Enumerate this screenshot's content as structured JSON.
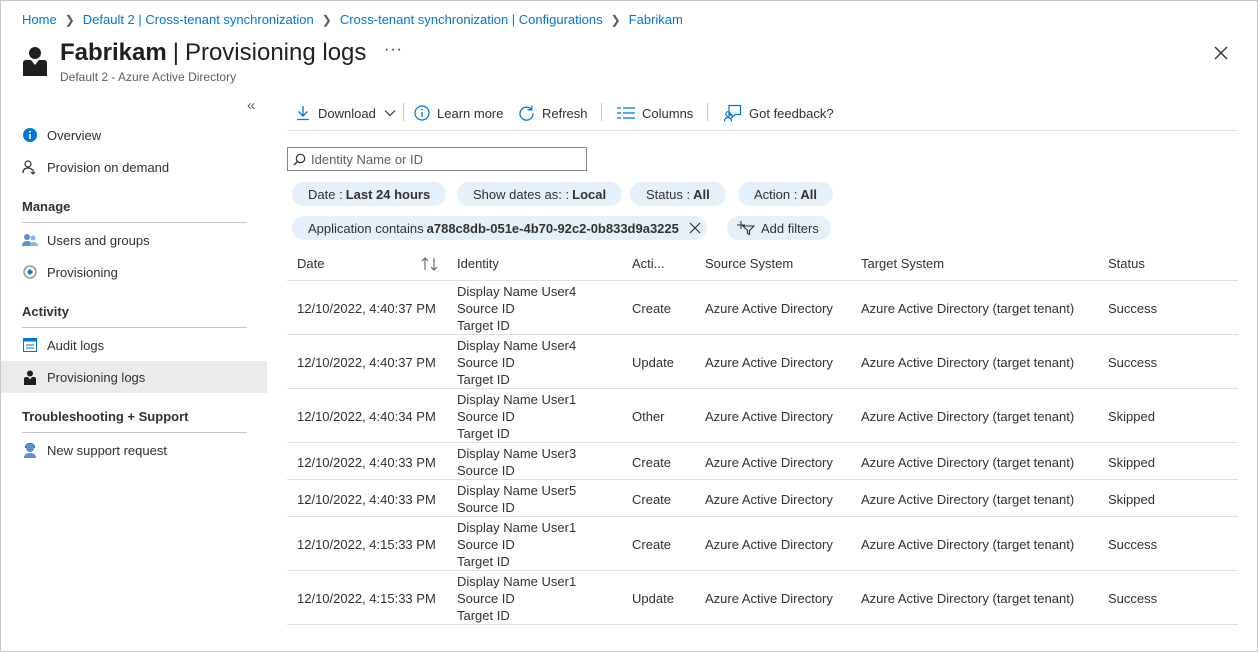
{
  "breadcrumb": [
    "Home",
    "Default 2 | Cross-tenant synchronization",
    "Cross-tenant synchronization | Configurations",
    "Fabrikam"
  ],
  "header": {
    "title_bold": "Fabrikam",
    "title_rest": "Provisioning logs",
    "subtitle": "Default 2 - Azure Active Directory",
    "more": "···"
  },
  "sidebar": {
    "collapse": "«",
    "items": [
      {
        "label": "Overview",
        "icon": "info-icon"
      },
      {
        "label": "Provision on demand",
        "icon": "user-provision-icon"
      }
    ],
    "sections": [
      {
        "heading": "Manage",
        "items": [
          {
            "label": "Users and groups",
            "icon": "users-icon"
          },
          {
            "label": "Provisioning",
            "icon": "provisioning-icon"
          }
        ]
      },
      {
        "heading": "Activity",
        "items": [
          {
            "label": "Audit logs",
            "icon": "audit-icon"
          },
          {
            "label": "Provisioning logs",
            "icon": "person-icon"
          }
        ]
      },
      {
        "heading": "Troubleshooting + Support",
        "items": [
          {
            "label": "New support request",
            "icon": "support-icon"
          }
        ]
      }
    ]
  },
  "toolbar": {
    "download": "Download",
    "learn_more": "Learn more",
    "refresh": "Refresh",
    "columns": "Columns",
    "feedback": "Got feedback?"
  },
  "search": {
    "placeholder": "Identity Name or ID",
    "value": ""
  },
  "filters": {
    "date_label": "Date :",
    "date_value": "Last 24 hours",
    "show_dates_label": "Show dates as: :",
    "show_dates_value": "Local",
    "status_label": "Status :",
    "status_value": "All",
    "action_label": "Action :",
    "action_value": "All",
    "app_label": "Application contains",
    "app_value": "a788c8db-051e-4b70-92c2-0b833d9a3225",
    "add_filters": "Add filters"
  },
  "table": {
    "columns": [
      "Date",
      "Identity",
      "Acti...",
      "Source System",
      "Target System",
      "Status"
    ],
    "rows": [
      {
        "date": "12/10/2022, 4:40:37 PM",
        "identity": [
          "Display Name User4",
          "Source ID",
          "Target ID"
        ],
        "action": "Create",
        "source": "Azure Active Directory",
        "target": "Azure Active Directory (target tenant)",
        "status": "Success"
      },
      {
        "date": "12/10/2022, 4:40:37 PM",
        "identity": [
          "Display Name User4",
          "Source ID",
          "Target ID"
        ],
        "action": "Update",
        "source": "Azure Active Directory",
        "target": "Azure Active Directory (target tenant)",
        "status": "Success"
      },
      {
        "date": "12/10/2022, 4:40:34 PM",
        "identity": [
          "Display Name User1",
          "Source ID",
          "Target ID"
        ],
        "action": "Other",
        "source": "Azure Active Directory",
        "target": "Azure Active Directory (target tenant)",
        "status": "Skipped"
      },
      {
        "date": "12/10/2022, 4:40:33 PM",
        "identity": [
          "Display Name User3",
          "Source ID"
        ],
        "action": "Create",
        "source": "Azure Active Directory",
        "target": "Azure Active Directory (target tenant)",
        "status": "Skipped"
      },
      {
        "date": "12/10/2022, 4:40:33 PM",
        "identity": [
          "Display Name User5",
          "Source ID"
        ],
        "action": "Create",
        "source": "Azure Active Directory",
        "target": "Azure Active Directory (target tenant)",
        "status": "Skipped"
      },
      {
        "date": "12/10/2022, 4:15:33 PM",
        "identity": [
          "Display Name User1",
          "Source ID",
          "Target ID"
        ],
        "action": "Create",
        "source": "Azure Active Directory",
        "target": "Azure Active Directory (target tenant)",
        "status": "Success"
      },
      {
        "date": "12/10/2022, 4:15:33 PM",
        "identity": [
          "Display Name User1",
          "Source ID",
          "Target ID"
        ],
        "action": "Update",
        "source": "Azure Active Directory",
        "target": "Azure Active Directory (target tenant)",
        "status": "Success"
      }
    ]
  }
}
